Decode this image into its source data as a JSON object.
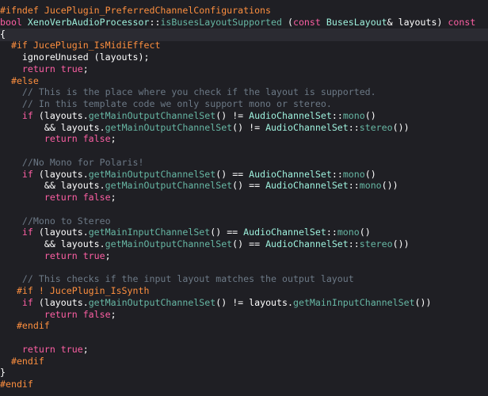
{
  "colors": {
    "background": "#1f1f24",
    "current_line": "#2b2b32",
    "plain": "#ffffff",
    "preprocessor": "#fd8f3f",
    "keyword": "#fc5fa3",
    "comment": "#6c7986",
    "type": "#d0a8ff",
    "method": "#67b7a4",
    "project_type": "#9ef1dd",
    "class_type": "#5dd8ff"
  },
  "code": {
    "lines": [
      [
        [
          "preprocessor",
          "#ifndef JucePlugin_PreferredChannelConfigurations"
        ]
      ],
      [
        [
          "keyword",
          "bool "
        ],
        [
          "project_type",
          "XenoVerbAudioProcessor"
        ],
        [
          "plain",
          "::"
        ],
        [
          "method",
          "isBusesLayoutSupported"
        ],
        [
          "plain",
          " ("
        ],
        [
          "keyword",
          "const "
        ],
        [
          "project_type",
          "BusesLayout"
        ],
        [
          "plain",
          "& layouts) "
        ],
        [
          "keyword",
          "const"
        ]
      ],
      [
        [
          "plain",
          "{"
        ]
      ],
      [
        [
          "preprocessor",
          "  #if JucePlugin_IsMidiEffect"
        ]
      ],
      [
        [
          "plain",
          "    ignoreUnused (layouts);"
        ]
      ],
      [
        [
          "plain",
          "    "
        ],
        [
          "keyword",
          "return true"
        ],
        [
          "plain",
          ";"
        ]
      ],
      [
        [
          "preprocessor",
          "  #else"
        ]
      ],
      [
        [
          "comment",
          "    // This is the place where you check if the layout is supported."
        ]
      ],
      [
        [
          "comment",
          "    // In this template code we only support mono or stereo."
        ]
      ],
      [
        [
          "plain",
          "    "
        ],
        [
          "keyword",
          "if"
        ],
        [
          "plain",
          " (layouts."
        ],
        [
          "method",
          "getMainOutputChannelSet"
        ],
        [
          "plain",
          "() != "
        ],
        [
          "project_type",
          "AudioChannelSet"
        ],
        [
          "plain",
          "::"
        ],
        [
          "method",
          "mono"
        ],
        [
          "plain",
          "()"
        ]
      ],
      [
        [
          "plain",
          "        && layouts."
        ],
        [
          "method",
          "getMainOutputChannelSet"
        ],
        [
          "plain",
          "() != "
        ],
        [
          "project_type",
          "AudioChannelSet"
        ],
        [
          "plain",
          "::"
        ],
        [
          "method",
          "stereo"
        ],
        [
          "plain",
          "())"
        ]
      ],
      [
        [
          "plain",
          "        "
        ],
        [
          "keyword",
          "return false"
        ],
        [
          "plain",
          ";"
        ]
      ],
      [
        [
          "plain",
          ""
        ]
      ],
      [
        [
          "comment",
          "    //No Mono for Polaris!"
        ]
      ],
      [
        [
          "plain",
          "    "
        ],
        [
          "keyword",
          "if"
        ],
        [
          "plain",
          " (layouts."
        ],
        [
          "method",
          "getMainOutputChannelSet"
        ],
        [
          "plain",
          "() == "
        ],
        [
          "project_type",
          "AudioChannelSet"
        ],
        [
          "plain",
          "::"
        ],
        [
          "method",
          "mono"
        ],
        [
          "plain",
          "()"
        ]
      ],
      [
        [
          "plain",
          "        && layouts."
        ],
        [
          "method",
          "getMainOutputChannelSet"
        ],
        [
          "plain",
          "() == "
        ],
        [
          "project_type",
          "AudioChannelSet"
        ],
        [
          "plain",
          "::"
        ],
        [
          "method",
          "mono"
        ],
        [
          "plain",
          "())"
        ]
      ],
      [
        [
          "plain",
          "        "
        ],
        [
          "keyword",
          "return false"
        ],
        [
          "plain",
          ";"
        ]
      ],
      [
        [
          "plain",
          ""
        ]
      ],
      [
        [
          "comment",
          "    //Mono to Stereo"
        ]
      ],
      [
        [
          "plain",
          "    "
        ],
        [
          "keyword",
          "if"
        ],
        [
          "plain",
          " (layouts."
        ],
        [
          "method",
          "getMainInputChannelSet"
        ],
        [
          "plain",
          "() == "
        ],
        [
          "project_type",
          "AudioChannelSet"
        ],
        [
          "plain",
          "::"
        ],
        [
          "method",
          "mono"
        ],
        [
          "plain",
          "()"
        ]
      ],
      [
        [
          "plain",
          "        && layouts."
        ],
        [
          "method",
          "getMainOutputChannelSet"
        ],
        [
          "plain",
          "() == "
        ],
        [
          "project_type",
          "AudioChannelSet"
        ],
        [
          "plain",
          "::"
        ],
        [
          "method",
          "stereo"
        ],
        [
          "plain",
          "())"
        ]
      ],
      [
        [
          "plain",
          "        "
        ],
        [
          "keyword",
          "return true"
        ],
        [
          "plain",
          ";"
        ]
      ],
      [
        [
          "plain",
          ""
        ]
      ],
      [
        [
          "comment",
          "    // This checks if the input layout matches the output layout"
        ]
      ],
      [
        [
          "preprocessor",
          "   #if ! JucePlugin_IsSynth"
        ]
      ],
      [
        [
          "plain",
          "    "
        ],
        [
          "keyword",
          "if"
        ],
        [
          "plain",
          " (layouts."
        ],
        [
          "method",
          "getMainOutputChannelSet"
        ],
        [
          "plain",
          "() != layouts."
        ],
        [
          "method",
          "getMainInputChannelSet"
        ],
        [
          "plain",
          "())"
        ]
      ],
      [
        [
          "plain",
          "        "
        ],
        [
          "keyword",
          "return false"
        ],
        [
          "plain",
          ";"
        ]
      ],
      [
        [
          "preprocessor",
          "   #endif"
        ]
      ],
      [
        [
          "plain",
          ""
        ]
      ],
      [
        [
          "plain",
          "    "
        ],
        [
          "keyword",
          "return true"
        ],
        [
          "plain",
          ";"
        ]
      ],
      [
        [
          "preprocessor",
          "  #endif"
        ]
      ],
      [
        [
          "plain",
          "}"
        ]
      ],
      [
        [
          "preprocessor",
          "#endif"
        ]
      ]
    ]
  }
}
